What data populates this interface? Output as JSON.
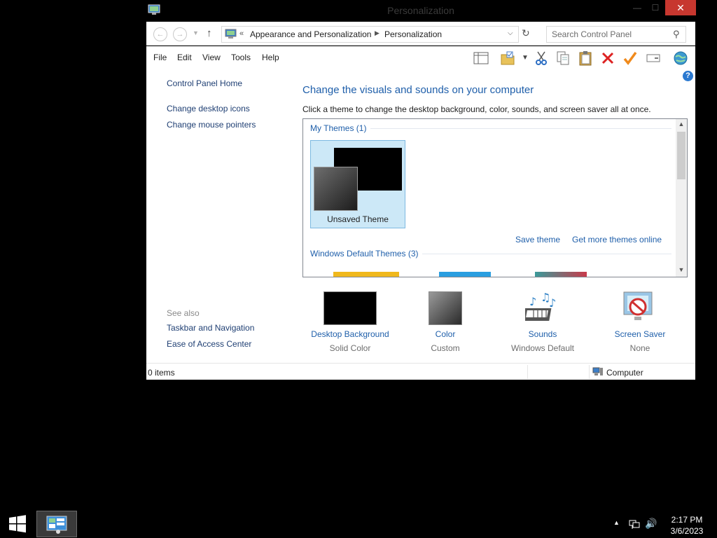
{
  "window": {
    "title": "Personalization",
    "minimize": "—",
    "maximize": "☐",
    "close": "✕"
  },
  "address": {
    "chevrons": "«",
    "crumbs": [
      "Appearance and Personalization",
      "Personalization"
    ],
    "search_placeholder": "Search Control Panel"
  },
  "menu": [
    "File",
    "Edit",
    "View",
    "Tools",
    "Help"
  ],
  "toolbar_icons": [
    "layout-icon",
    "folder-properties-icon",
    "cut-icon",
    "copy-icon",
    "paste-icon",
    "delete-icon",
    "check-icon",
    "rename-icon",
    "globe-icon"
  ],
  "sidebar": {
    "home": "Control Panel Home",
    "links": [
      "Change desktop icons",
      "Change mouse pointers"
    ],
    "see_also_label": "See also",
    "see_also": [
      "Taskbar and Navigation",
      "Ease of Access Center"
    ]
  },
  "main": {
    "heading": "Change the visuals and sounds on your computer",
    "description": "Click a theme to change the desktop background, color, sounds, and screen saver all at once.",
    "my_themes_label": "My Themes (1)",
    "selected_theme": "Unsaved Theme",
    "save_theme": "Save theme",
    "get_more": "Get more themes online",
    "default_themes_label": "Windows Default Themes (3)"
  },
  "settings": [
    {
      "label": "Desktop Background",
      "value": "Solid Color"
    },
    {
      "label": "Color",
      "value": "Custom"
    },
    {
      "label": "Sounds",
      "value": "Windows Default"
    },
    {
      "label": "Screen Saver",
      "value": "None"
    }
  ],
  "status": {
    "items": "0 items",
    "location": "Computer"
  },
  "taskbar": {
    "time": "2:17 PM",
    "date": "3/6/2023"
  },
  "colors": {
    "link": "#1f5faa",
    "selection": "#cce8f7",
    "close": "#c7372f"
  }
}
